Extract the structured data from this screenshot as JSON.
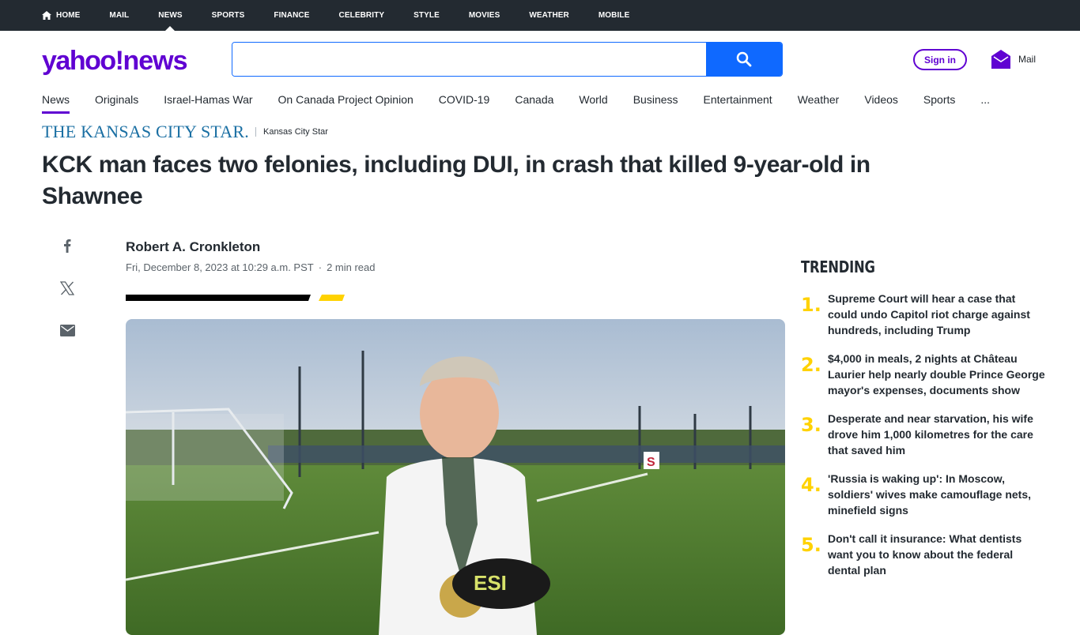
{
  "top_nav": [
    {
      "label": "HOME",
      "icon": "home-icon"
    },
    {
      "label": "MAIL"
    },
    {
      "label": "NEWS",
      "active": true
    },
    {
      "label": "SPORTS"
    },
    {
      "label": "FINANCE"
    },
    {
      "label": "CELEBRITY"
    },
    {
      "label": "STYLE"
    },
    {
      "label": "MOVIES"
    },
    {
      "label": "WEATHER"
    },
    {
      "label": "MOBILE"
    }
  ],
  "header": {
    "logo_yahoo": "yahoo!",
    "logo_news": "news",
    "search_value": "",
    "search_icon": "search-icon",
    "sign_in": "Sign in",
    "mail_label": "Mail",
    "mail_icon": "mail-icon"
  },
  "sub_nav": [
    "News",
    "Originals",
    "Israel-Hamas War",
    "On Canada Project Opinion",
    "COVID-19",
    "Canada",
    "World",
    "Business",
    "Entertainment",
    "Weather",
    "Videos",
    "Sports",
    "..."
  ],
  "article": {
    "publisher": "THE KANSAS CITY STAR.",
    "provider": "Kansas City Star",
    "title": "KCK man faces two felonies, including DUI, in crash that killed 9-year-old in Shawnee",
    "author": "Robert A. Cronkleton",
    "date": "Fri, December 8, 2023 at 10:29 a.m. PST",
    "read_time": "2 min read",
    "share_icons": [
      "facebook-icon",
      "x-icon",
      "email-icon"
    ]
  },
  "trending": {
    "title": "TRENDING",
    "items": [
      {
        "num": "1.",
        "text": "Supreme Court will hear a case that could undo Capitol riot charge against hundreds, including Trump"
      },
      {
        "num": "2.",
        "text": "$4,000 in meals, 2 nights at Château Laurier help nearly double Prince George mayor's expenses, documents show"
      },
      {
        "num": "3.",
        "text": "Desperate and near starvation, his wife drove him 1,000 kilometres for the care that saved him"
      },
      {
        "num": "4.",
        "text": "'Russia is waking up': In Moscow, soldiers' wives make camouflage nets, minefield signs"
      },
      {
        "num": "5.",
        "text": "Don't call it insurance: What dentists want you to know about the federal dental plan"
      }
    ]
  },
  "colors": {
    "brand": "#6001d2",
    "topbar": "#232a31",
    "search_button": "#0f69ff",
    "trend_number": "#ffd200",
    "publisher": "#1a6fa3"
  }
}
